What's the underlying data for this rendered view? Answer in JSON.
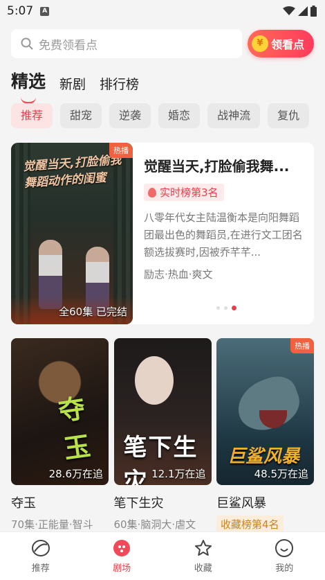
{
  "status_bar": {
    "time": "5:07",
    "notif_icon": "A"
  },
  "search": {
    "placeholder": "免费领看点",
    "coin_button": "领看点",
    "coin_symbol": "¥"
  },
  "tabs": [
    {
      "label": "精选",
      "active": true
    },
    {
      "label": "新剧",
      "active": false
    },
    {
      "label": "排行榜",
      "active": false
    }
  ],
  "chips": [
    "推荐",
    "甜宠",
    "逆袭",
    "婚恋",
    "战神流",
    "复仇"
  ],
  "featured": {
    "poster_title_line1": "觉醒当天,打脸偷我",
    "poster_title_line2": "舞蹈动作的闺蜜",
    "badge": "热播",
    "episodes": "全60集  已完结",
    "title": "觉醒当天,打脸偷我舞...",
    "rank": "实时榜第3名",
    "description": "八零年代女主陆温衡本是向阳舞蹈团最出色的舞蹈员,在进行文工团名额选拔赛时,因被乔芊芊...",
    "tags": "励志·热血·爽文"
  },
  "cards": [
    {
      "art": "夺玉",
      "count": "28.6万在追",
      "name": "夺玉",
      "meta": "70集·正能量·智斗",
      "badge": "",
      "rank": ""
    },
    {
      "art": "笔下生灾",
      "count": "12.1万在追",
      "name": "笔下生灾",
      "meta": "60集·脑洞大·虐文",
      "badge": "",
      "rank": ""
    },
    {
      "art": "巨鲨风暴",
      "count": "48.5万在追",
      "name": "巨鲨风暴",
      "meta": "",
      "badge": "热播",
      "rank": "收藏榜第4名"
    }
  ],
  "bottom_nav": [
    {
      "label": "推荐",
      "icon": "recommend-icon",
      "active": false
    },
    {
      "label": "剧场",
      "icon": "theater-icon",
      "active": true
    },
    {
      "label": "收藏",
      "icon": "star-icon",
      "active": false
    },
    {
      "label": "我的",
      "icon": "profile-icon",
      "active": false
    }
  ],
  "colors": {
    "accent": "#e8404b",
    "coin_gradient_start": "#ff6a57",
    "coin_gradient_end": "#ff3b5c",
    "hot_badge": "#f2613f"
  }
}
